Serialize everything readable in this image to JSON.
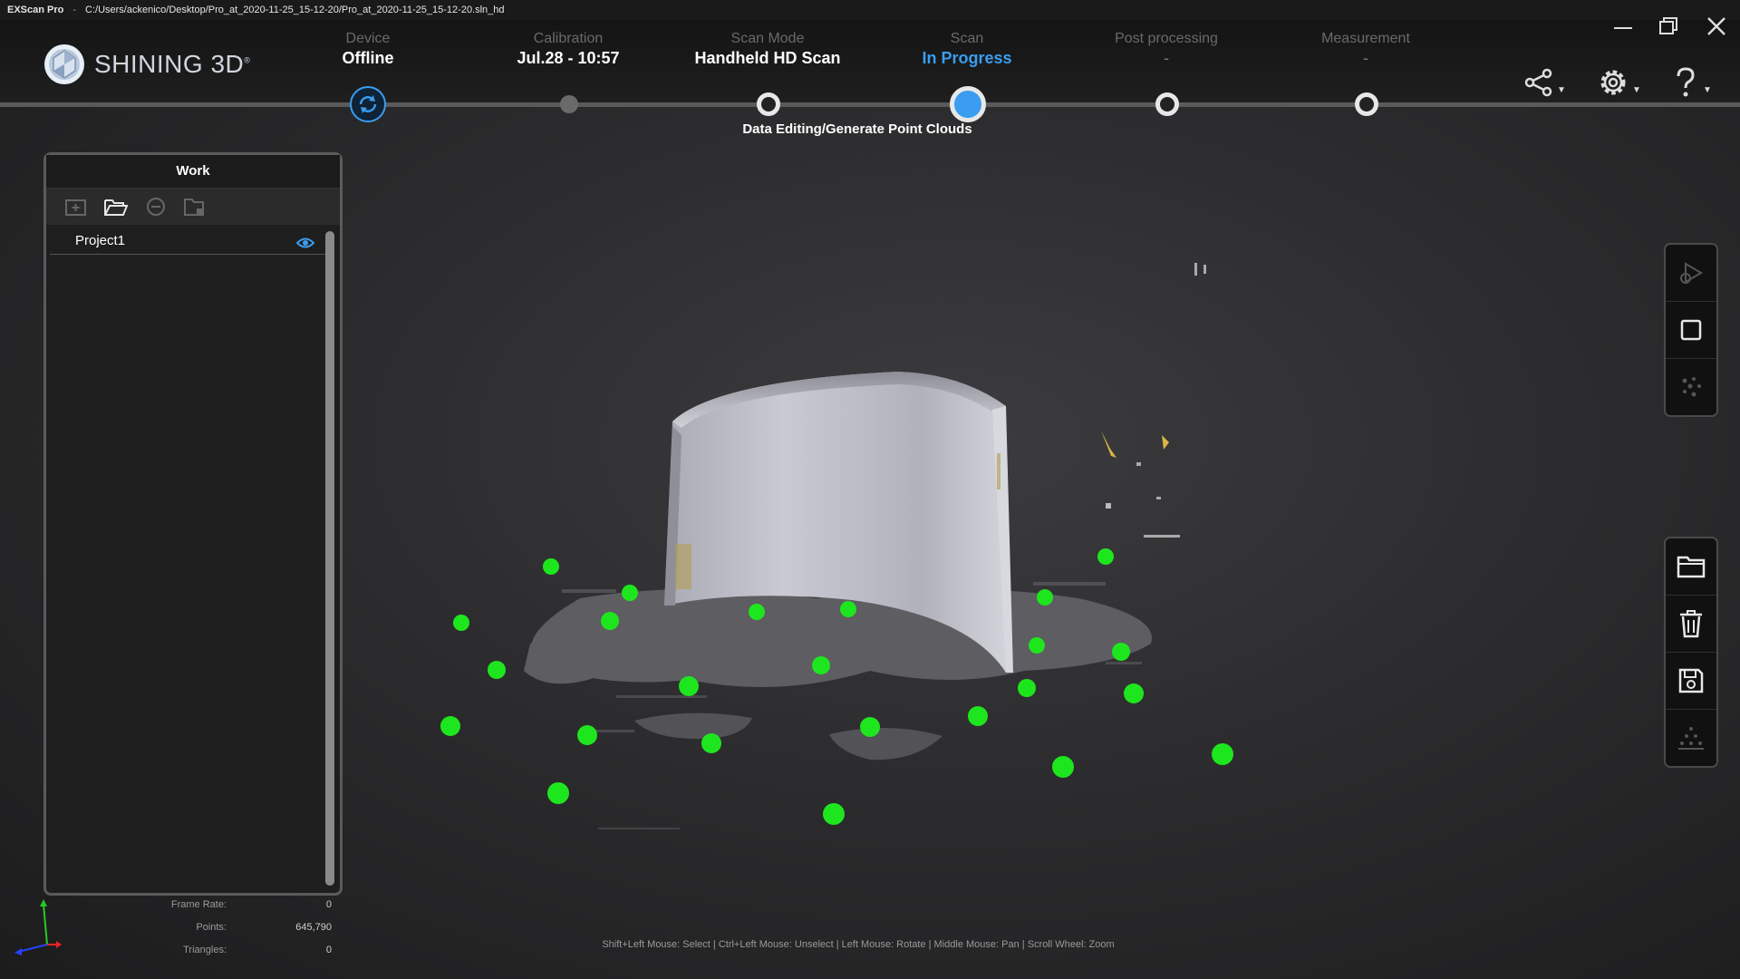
{
  "titlebar": {
    "app_name": "EXScan Pro",
    "separator": "-",
    "file_path": "C:/Users/ackenico/Desktop/Pro_at_2020-11-25_15-12-20/Pro_at_2020-11-25_15-12-20.sln_hd"
  },
  "logo": {
    "text": "SHINING 3D",
    "mark": "®"
  },
  "workflow": {
    "steps": [
      {
        "label": "Device",
        "value": "Offline"
      },
      {
        "label": "Calibration",
        "value": "Jul.28 - 10:57"
      },
      {
        "label": "Scan Mode",
        "value": "Handheld HD Scan"
      },
      {
        "label": "Scan",
        "value": "In Progress"
      },
      {
        "label": "Post processing",
        "value": "-"
      },
      {
        "label": "Measurement",
        "value": "-"
      }
    ],
    "current_caption": "Data Editing/Generate Point Clouds",
    "accent_color": "#3a9df0"
  },
  "header_icons": [
    "share-icon",
    "settings-icon",
    "help-icon"
  ],
  "work_panel": {
    "title": "Work",
    "toolbar_icons": [
      "new-group-icon",
      "open-folder-icon",
      "remove-icon",
      "folder-settings-icon"
    ],
    "items": [
      {
        "name": "Project1",
        "visible": true
      }
    ]
  },
  "right_toolbar_top": [
    "start-scan-icon",
    "stop-icon",
    "point-cloud-icon"
  ],
  "right_toolbar_bottom": [
    "open-folder-icon",
    "delete-icon",
    "save-icon",
    "mesh-icon"
  ],
  "stats": {
    "frame_rate_label": "Frame Rate:",
    "frame_rate": "0",
    "points_label": "Points:",
    "points": "645,790",
    "triangles_label": "Triangles:",
    "triangles": "0"
  },
  "hint": "Shift+Left Mouse: Select  |  Ctrl+Left Mouse: Unselect | Left Mouse: Rotate  |  Middle Mouse: Pan  |  Scroll Wheel: Zoom",
  "marker_color": "#1ee61e"
}
